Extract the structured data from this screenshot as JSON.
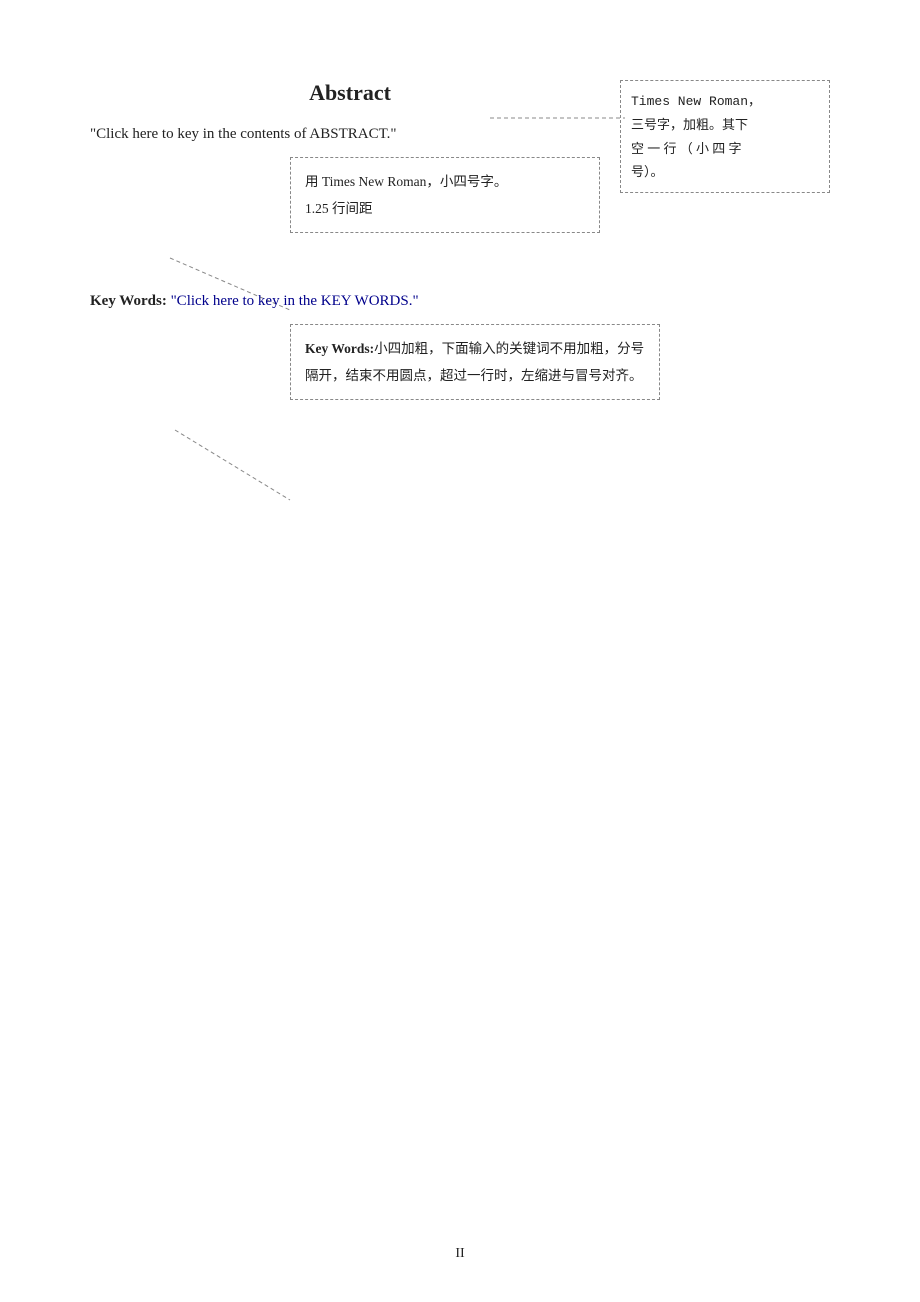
{
  "page": {
    "number": "II",
    "background": "#ffffff"
  },
  "abstract_section": {
    "title": "Abstract",
    "content_text": "\"Click here to key in the contents of ABSTRACT.\"",
    "annotation_tr": {
      "line1": "Times New Roman，",
      "line2": "三号字，加粗。其下",
      "line3": "空 一 行 （ 小 四 字",
      "line4": "号）。"
    },
    "annotation_mid": {
      "line1": "用 Times New Roman，小四号字。",
      "line2": "1.25 行间距"
    }
  },
  "keywords_section": {
    "label": "Key Words:",
    "link_text": "\"Click here to key in the KEY WORDS.\"",
    "annotation_bottom": {
      "bold_part": "Key Words:",
      "text": "小四加粗，下面输入的关键词不用加粗，分号隔开，结束不用圆点，超过一行时，左缩进与冒号对齐。"
    }
  }
}
